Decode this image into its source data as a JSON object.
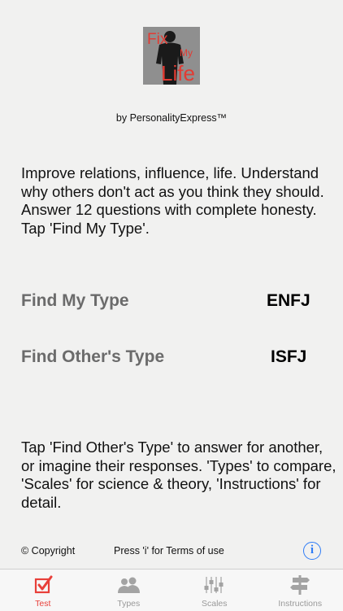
{
  "logo": {
    "line1": "Fix",
    "line2": "My",
    "line3": "Life"
  },
  "byline": "by PersonalityExpress™",
  "intro": "Improve relations, influence, life. Understand why others don't act as you think they should. Answer 12 questions with complete honesty.  Tap 'Find My Type'.",
  "find_my_type": {
    "label": "Find My Type",
    "value": "ENFJ"
  },
  "find_others_type": {
    "label": "Find Other's Type",
    "value": "ISFJ"
  },
  "info_text": "Tap 'Find Other's Type' to answer for another, or imagine their responses. 'Types' to compare, 'Scales' for science & theory, 'Instructions' for detail.",
  "footer": {
    "copyright": "© Copyright",
    "terms": "Press 'i' for Terms of use",
    "info_icon": "i"
  },
  "tabs": [
    {
      "label": "Test",
      "icon": "checkbox-icon",
      "active": true
    },
    {
      "label": "Types",
      "icon": "people-icon",
      "active": false
    },
    {
      "label": "Scales",
      "icon": "sliders-icon",
      "active": false
    },
    {
      "label": "Instructions",
      "icon": "signpost-icon",
      "active": false
    }
  ],
  "colors": {
    "accent": "#e8403a",
    "link": "#2f7cf6",
    "label_gray": "#6b6b6b",
    "background": "#f1f1f0"
  }
}
